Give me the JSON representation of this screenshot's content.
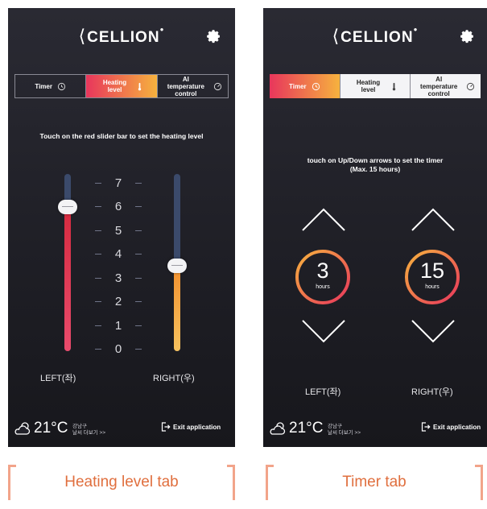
{
  "brand": "CELLION",
  "colors": {
    "accent_start": "#e8365c",
    "accent_end": "#f6b23e",
    "background": "#22222a",
    "track": "#3b4a6b",
    "caption": "#e06f3e"
  },
  "icons": {
    "settings": "gear-icon",
    "timer": "clock-icon",
    "heating": "thermometer-icon",
    "ai": "ai-dial-icon",
    "weather": "cloud-sun-icon",
    "exit": "exit-icon"
  },
  "heating_screen": {
    "tabs": [
      {
        "label": "Timer",
        "active": false
      },
      {
        "label": "Heating level",
        "active": true
      },
      {
        "label": "AI temperature control",
        "active": false
      }
    ],
    "instruction": "Touch on the red slider bar to set the heating level",
    "scale": [
      "7",
      "6",
      "5",
      "4",
      "3",
      "2",
      "1",
      "0"
    ],
    "scale_max": 7,
    "left": {
      "label": "LEFT(좌)",
      "level": 6
    },
    "right": {
      "label": "RIGHT(우)",
      "level": 3.5
    },
    "weather": {
      "temperature": "21°C",
      "district": "강남구",
      "more": "날씨 더보기 >>"
    },
    "exit_label": "Exit application",
    "caption": "Heating level tab"
  },
  "timer_screen": {
    "tabs": [
      {
        "label": "Timer",
        "active": true
      },
      {
        "label": "Heating level",
        "active": false
      },
      {
        "label": "AI temperature control",
        "active": false
      }
    ],
    "instruction": "touch on Up/Down arrows to set the timer\n(Max. 15 hours)",
    "left": {
      "label": "LEFT(좌)",
      "hours": "3",
      "unit": "hours"
    },
    "right": {
      "label": "RIGHT(우)",
      "hours": "15",
      "unit": "hours"
    },
    "weather": {
      "temperature": "21°C",
      "district": "강남구",
      "more": "날씨 더보기 >>"
    },
    "exit_label": "Exit application",
    "caption": "Timer tab"
  }
}
